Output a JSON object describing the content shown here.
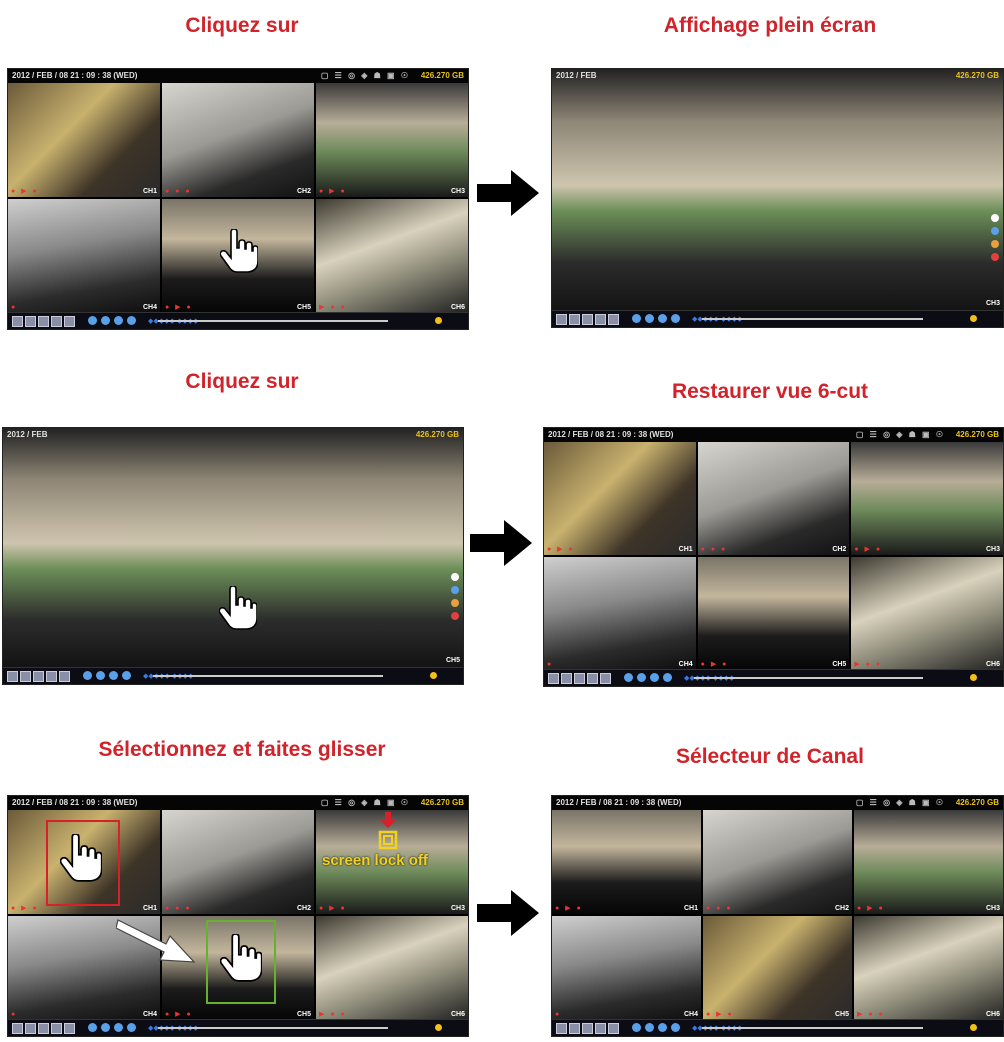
{
  "captions": {
    "row1_left": "Cliquez sur",
    "row1_right": "Affichage plein écran",
    "row2_left": "Cliquez sur",
    "row2_right": "Restaurer vue 6-cut",
    "row3_left": "Sélectionnez et faites glisser",
    "row3_right": "Sélecteur de Canal"
  },
  "dvr": {
    "datetime": "2012 / FEB / 08  21 : 09 : 38 (WED)",
    "datetime_short": "2012 / FEB",
    "hdd": "426.270 GB",
    "status_icons": "▢ ☰ ◎ ◈ ☗ ▣ ☉",
    "channels": [
      "CH1",
      "CH2",
      "CH3",
      "CH4",
      "CH5",
      "CH6"
    ],
    "full_channel_a": "CH3",
    "full_channel_b": "CH5",
    "blue_marks": "◆◆◆◆◆ ◆◆◆◆"
  },
  "lock_text": "screen lock off",
  "colors": {
    "caption": "#d2222a",
    "hdd": "#e8c21e",
    "arrow": "#000000",
    "select_red": "#d8202a",
    "select_green": "#68b030"
  }
}
